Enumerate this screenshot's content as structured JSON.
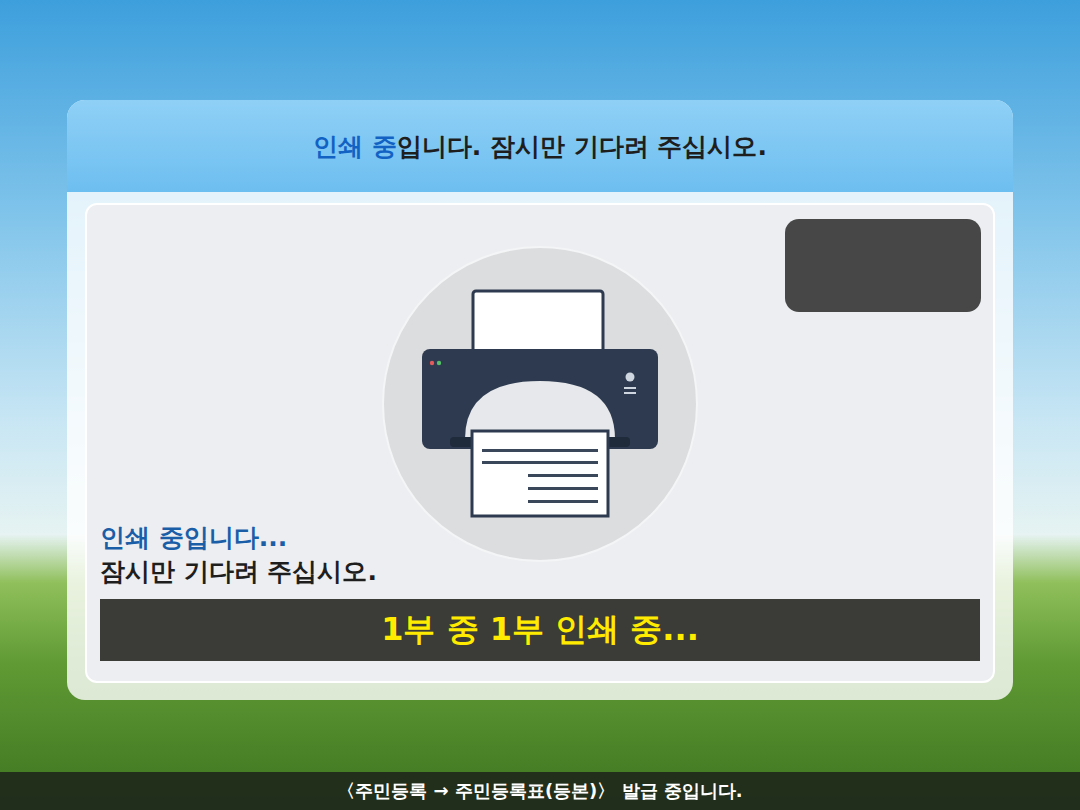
{
  "header": {
    "highlight": "인쇄 중",
    "rest": "입니다. 잠시만 기다려 주십시오."
  },
  "status": {
    "line1": "인쇄 중입니다...",
    "line2": "잠시만 기다려 주십시오."
  },
  "progress": {
    "text": "1부 중 1부 인쇄 중..."
  },
  "footer": {
    "text": "〈주민등록 → 주민등록표(등본)〉 발급 중입니다."
  }
}
